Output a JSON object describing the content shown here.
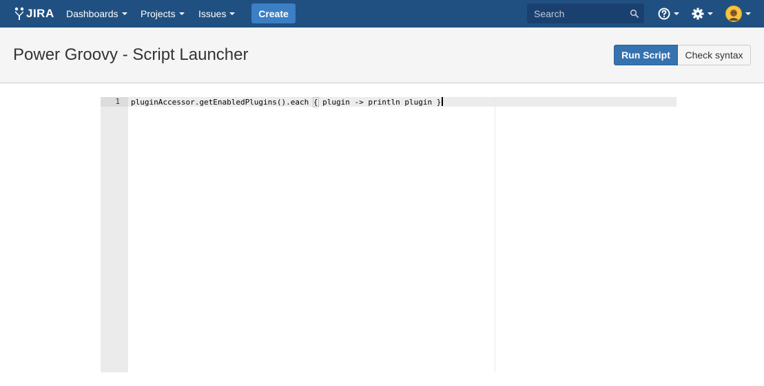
{
  "topbar": {
    "logo_text": "JIRA",
    "nav": {
      "dashboards": "Dashboards",
      "projects": "Projects",
      "issues": "Issues"
    },
    "create_label": "Create",
    "search_placeholder": "Search",
    "icons": {
      "logo": "jira-logo-icon",
      "search": "search-icon",
      "help": "help-icon",
      "settings": "gear-icon",
      "avatar": "user-avatar"
    },
    "colors": {
      "bar": "#205081",
      "create": "#3b7fc4"
    }
  },
  "page": {
    "title": "Power Groovy - Script Launcher",
    "run_label": "Run Script",
    "check_label": "Check syntax"
  },
  "editor": {
    "line_number": "1",
    "code_before": "pluginAccessor.getEnabledPlugins().each ",
    "code_open_brace": "{",
    "code_middle": " plugin -> println plugin ",
    "code_close_brace": "}"
  }
}
